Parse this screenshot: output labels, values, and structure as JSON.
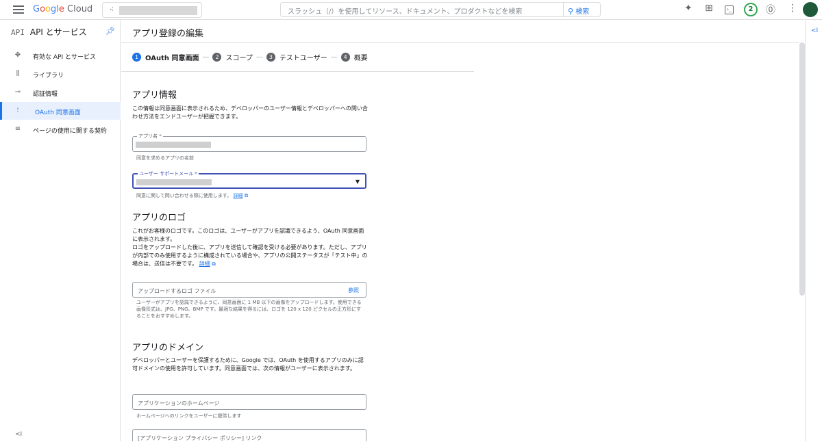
{
  "topbar": {
    "logo_letters": [
      "G",
      "o",
      "o",
      "g",
      "l",
      "e"
    ],
    "logo_product": "Cloud",
    "search_placeholder": "スラッシュ（/）を使用してリソース、ドキュメント、プロダクトなどを検索",
    "search_button": "検索",
    "notifications_count": "2"
  },
  "sidebar": {
    "api_glyph": "API",
    "title": "API とサービス",
    "items": [
      {
        "icon": "✥",
        "label": "有効な API とサービス"
      },
      {
        "icon": "⫼",
        "label": "ライブラリ"
      },
      {
        "icon": "⊸",
        "label": "認証情報"
      },
      {
        "icon": "⁝",
        "label": "OAuth 同意画面"
      },
      {
        "icon": "≡",
        "label": "ページの使用に関する契約"
      }
    ],
    "collapse_glyph": "<I"
  },
  "main": {
    "title": "アプリ登録の編集",
    "steps": [
      {
        "num": "1",
        "label": "OAuth 同意画面"
      },
      {
        "num": "2",
        "label": "スコープ"
      },
      {
        "num": "3",
        "label": "テストユーザー"
      },
      {
        "num": "4",
        "label": "概要"
      }
    ],
    "app_info": {
      "heading": "アプリ情報",
      "desc": "この情報は同意画面に表示されるため、デベロッパーのユーザー情報とデベロッパーへの問い合わせ方法をエンドユーザーが把握できます。",
      "app_name_label": "アプリ名 *",
      "app_name_hint": "同意を求めるアプリの名前",
      "support_email_label": "ユーザー サポートメール *",
      "support_email_hint": "同意に関して問い合わせる際に使用します。",
      "details_link": "詳細"
    },
    "logo_section": {
      "heading": "アプリのロゴ",
      "desc_1": "これがお客様のロゴです。このロゴは、ユーザーがアプリを認識できるよう、OAuth 同意画面に表示されます。",
      "desc_2": "ロゴをアップロードした後に、アプリを送信して確認を受ける必要があります。ただし、アプリが内部でのみ使用するように構成されている場合や、アプリの公開ステータスが「テスト中」の場合は、送信は不要です。",
      "details_link": "詳細",
      "upload_placeholder": "アップロードするロゴ ファイル",
      "browse": "参照",
      "upload_hint": "ユーザーがアプリを認識できるように、同意画面に 1 MB 以下の画像をアップロードします。使用できる画像形式は、JPG、PNG、BMP です。最適な結果を得るには、ロゴを 120 x 120 ピクセルの正方形にすることをおすすめします。"
    },
    "domain_section": {
      "heading": "アプリのドメイン",
      "desc": "デベロッパーとユーザーを保護するために、Google では、OAuth を使用するアプリのみに認可ドメインの使用を許可しています。同意画面では、次の情報がユーザーに表示されます。",
      "homepage_placeholder": "アプリケーションのホームページ",
      "homepage_hint": "ホームページへのリンクをユーザーに提供します",
      "privacy_placeholder": "[アプリケーション プライバシー ポリシー] リンク"
    }
  },
  "colors": {
    "accent": "#1a73e8",
    "focus": "#3f51b5",
    "badge": "#34a853"
  }
}
